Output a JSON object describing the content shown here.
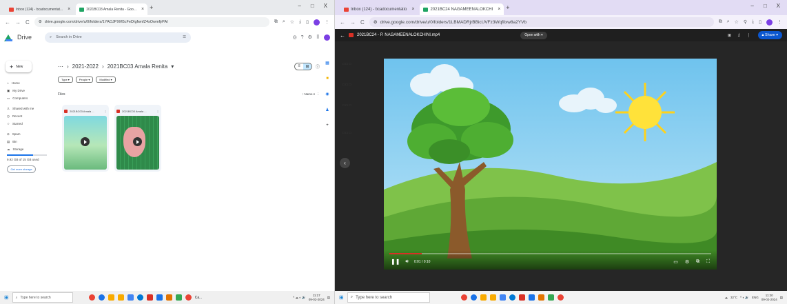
{
  "left_window": {
    "tabs": [
      {
        "label": "Inbox (124) - bcadocumentat...",
        "active": false
      },
      {
        "label": "2021BC03 Amala Renita - Goo...",
        "active": true
      }
    ],
    "new_tab": "+",
    "win_controls": [
      "–",
      "□",
      "X"
    ],
    "address": "drive.google.com/drive/u/0/folders/1YAOJPXM5cFeDIgfwnfZ4sOwmfjrPAI",
    "drive_name": "Drive",
    "search_placeholder": "Search in Drive",
    "new_button": "New",
    "nav": [
      "Home",
      "My Drive",
      "Computers",
      "Shared with me",
      "Recent",
      "Starred",
      "Spam",
      "Bin",
      "Storage"
    ],
    "storage_text": "9.92 GB of 15 GB used",
    "storage_fraction": 0.66,
    "get_storage": "Get more storage",
    "breadcrumb": [
      "2021-2022",
      "2021BC03 Amala Renita"
    ],
    "chips": [
      "Type ▾",
      "People ▾",
      "Modified ▾"
    ],
    "files_label": "Files",
    "sort_label": "Name ▾",
    "files": [
      {
        "name": "2021BC03 Amala ..."
      },
      {
        "name": "2021BC03 Amala ..."
      }
    ],
    "taskbar": {
      "search": "Type here to search",
      "running": "Ca...",
      "time": "11:17",
      "date": "09-02-2024"
    }
  },
  "right_window": {
    "tabs": [
      {
        "label": "Inbox (124) - bcadocumentatio",
        "active": false
      },
      {
        "label": "2021BC24 NAGAMEENALOKCHI",
        "active": true
      }
    ],
    "new_tab": "+",
    "win_controls": [
      "–",
      "□",
      "X"
    ],
    "address": "drive.google.com/drive/u/0/folders/1LBMADRjrBBicUVFz3Wqfilxw8a2YVb",
    "file_title": "2021BC24 - P. NAGAMEENALOKCHINI.mp4",
    "open_with": "Open with ▾",
    "share": "Share",
    "video": {
      "time": "0:01 / 0:10",
      "progress": 0.1
    },
    "taskbar": {
      "search": "Type here to search",
      "weather": "32°C",
      "lang": "ENG",
      "time": "11:20",
      "date": "09-02-2024"
    }
  },
  "colors": {
    "drive_blue": "#0b57d0",
    "youtube_red": "#d93025",
    "sky": "#82ccf0",
    "grass": "#4e9a2f"
  }
}
